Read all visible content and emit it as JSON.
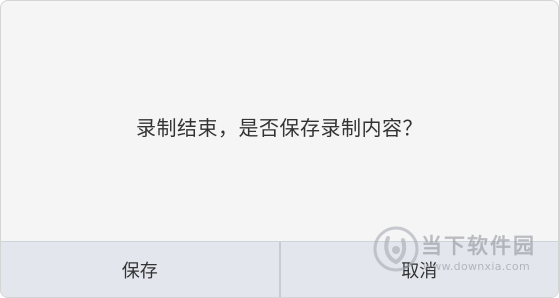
{
  "dialog": {
    "message": "录制结束，是否保存录制内容？",
    "save_label": "保存",
    "cancel_label": "取消"
  },
  "watermark": {
    "name": "当下软件园",
    "url": "www.downxia.com"
  }
}
